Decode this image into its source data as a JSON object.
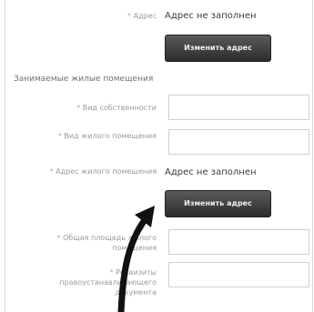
{
  "address_row": {
    "label": "Адрес",
    "value": "Адрес не заполнен",
    "button": "Изменить адрес"
  },
  "section_title": "Занимаемые жилые помещения",
  "fields": {
    "ownership_label": "Вид собственности",
    "housing_type_label": "Вид жилого помещения",
    "housing_address_label": "Адрес жилого помещения",
    "housing_address_value": "Адрес не заполнен",
    "housing_address_button": "Изменить адрес",
    "total_area_label": "Общая площадь жилого помещения",
    "ownership_docs_label": "Реквизиты правоустанавливающего документа"
  },
  "colors": {
    "button_bg": "#3a3a3a",
    "arrow": "#111111"
  },
  "icons": {
    "annotation": "curved-arrow-icon"
  }
}
